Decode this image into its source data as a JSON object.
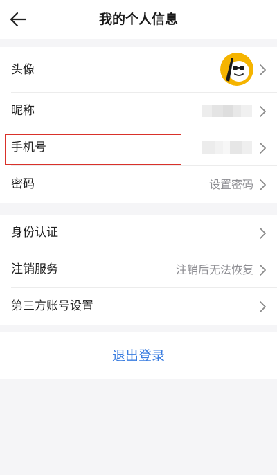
{
  "header": {
    "title": "我的个人信息",
    "back_icon": "arrow-left-icon"
  },
  "group1": {
    "avatar": {
      "label": "头像"
    },
    "nickname": {
      "label": "昵称"
    },
    "phone": {
      "label": "手机号"
    },
    "password": {
      "label": "密码",
      "value": "设置密码"
    }
  },
  "group2": {
    "identity": {
      "label": "身份认证"
    },
    "cancel": {
      "label": "注销服务",
      "value": "注销后无法恢复"
    },
    "third_party": {
      "label": "第三方账号设置"
    }
  },
  "logout": {
    "label": "退出登录"
  },
  "colors": {
    "accent_link": "#3a7de0",
    "highlight_border": "#d9312a",
    "avatar_bg": "#f5b400"
  }
}
